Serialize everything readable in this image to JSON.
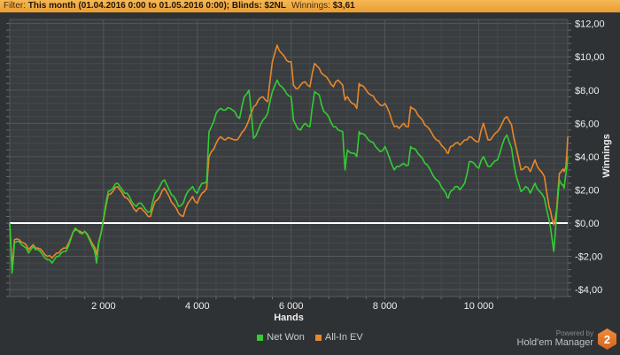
{
  "header": {
    "filter_label": "Filter:",
    "filter_value": "This month (01.04.2016 0:00 to 01.05.2016 0:00); Blinds: $2NL",
    "winnings_label": "Winnings:",
    "winnings_value": "$3,61"
  },
  "chart_data": {
    "type": "line",
    "xlabel": "Hands",
    "ylabel": "Winnings",
    "xlim": [
      0,
      11900
    ],
    "ylim": [
      -4.4,
      12.2
    ],
    "grid": {
      "minor_x_step": 400,
      "minor_y_step": 0.4,
      "major_x_step": 2000,
      "major_y_step": 2,
      "zero_line": 0
    },
    "x_ticks": [
      2000,
      4000,
      6000,
      8000,
      10000
    ],
    "x_tick_labels": [
      "2 000",
      "4 000",
      "6 000",
      "8 000",
      "10 000"
    ],
    "y_ticks": [
      12,
      10,
      8,
      6,
      4,
      2,
      0,
      -2,
      -4
    ],
    "y_tick_labels": [
      "$12,00",
      "$10,00",
      "$8,00",
      "$6,00",
      "$4,00",
      "$2,00",
      "$0,00",
      "-$2,00",
      "-$4,00"
    ],
    "x": [
      0,
      50,
      100,
      200,
      300,
      400,
      500,
      600,
      700,
      800,
      900,
      1000,
      1100,
      1200,
      1300,
      1400,
      1500,
      1600,
      1700,
      1800,
      1850,
      1900,
      2000,
      2100,
      2200,
      2300,
      2400,
      2500,
      2600,
      2700,
      2800,
      2900,
      3000,
      3100,
      3200,
      3300,
      3400,
      3500,
      3600,
      3700,
      3800,
      3900,
      4000,
      4100,
      4200,
      4250,
      4300,
      4400,
      4500,
      4600,
      4700,
      4800,
      4900,
      5000,
      5100,
      5150,
      5200,
      5300,
      5400,
      5500,
      5600,
      5700,
      5800,
      5900,
      6000,
      6050,
      6100,
      6200,
      6300,
      6400,
      6500,
      6600,
      6700,
      6800,
      6900,
      7000,
      7100,
      7150,
      7200,
      7300,
      7400,
      7450,
      7500,
      7600,
      7700,
      7800,
      7900,
      8000,
      8100,
      8200,
      8300,
      8400,
      8500,
      8550,
      8600,
      8700,
      8800,
      8900,
      9000,
      9100,
      9200,
      9300,
      9350,
      9400,
      9500,
      9600,
      9700,
      9800,
      9900,
      10000,
      10100,
      10200,
      10300,
      10400,
      10500,
      10600,
      10700,
      10800,
      10900,
      11000,
      11100,
      11200,
      11300,
      11400,
      11500,
      11560,
      11600,
      11660,
      11720,
      11780,
      11820,
      11860,
      11900
    ],
    "series": [
      {
        "name": "Net Won",
        "color": "#33cc33",
        "values": [
          0,
          -3,
          -1.2,
          -1.1,
          -1.4,
          -1.8,
          -1.4,
          -1.6,
          -1.9,
          -2.2,
          -2.4,
          -2,
          -1.8,
          -1.7,
          -1,
          -0.3,
          -0.6,
          -0.5,
          -1,
          -1.6,
          -2.4,
          -1.2,
          0.3,
          1.9,
          2.1,
          2.4,
          2,
          1.8,
          1.3,
          1,
          1.2,
          0.8,
          0.7,
          1.8,
          2.2,
          2.6,
          2,
          1.6,
          1,
          1.2,
          1.9,
          2.2,
          1.8,
          2.4,
          2.5,
          5.5,
          5.8,
          6.6,
          6.9,
          6.8,
          6.9,
          6.7,
          6.3,
          7.6,
          8,
          6.6,
          5.1,
          5.6,
          6.2,
          6.6,
          7.9,
          8.6,
          8.2,
          7.8,
          7.6,
          6.2,
          5.9,
          5.6,
          6,
          5.8,
          7.9,
          7.7,
          6.7,
          6.4,
          5.8,
          5.6,
          5.5,
          3.2,
          4.4,
          4.2,
          4,
          5.5,
          5.4,
          5.2,
          4.9,
          4.6,
          4.3,
          4.6,
          3.9,
          3.2,
          3.4,
          3.6,
          3.5,
          4.6,
          4.5,
          4.2,
          3.9,
          3.5,
          3,
          2.6,
          2.2,
          1.8,
          1.5,
          1.9,
          2.2,
          2,
          2.4,
          3.7,
          3.6,
          3.3,
          4,
          3.4,
          3.6,
          3.8,
          4.7,
          5.3,
          4.5,
          2.8,
          1.9,
          2.2,
          1.8,
          2.4,
          1.9,
          1.5,
          0.2,
          -0.9,
          -1.7,
          0.5,
          2.6,
          2.3,
          2.1,
          3,
          4
        ]
      },
      {
        "name": "All-In EV",
        "color": "#e8872b",
        "values": [
          0,
          -2.6,
          -1,
          -1,
          -1.2,
          -1.6,
          -1.3,
          -1.5,
          -1.7,
          -2,
          -2.1,
          -1.8,
          -1.6,
          -1.5,
          -0.9,
          -0.4,
          -0.5,
          -0.5,
          -0.9,
          -1.4,
          -1.9,
          -1.1,
          0.2,
          1.7,
          1.9,
          2.2,
          1.8,
          1.5,
          1.1,
          0.7,
          0.9,
          0.6,
          0.4,
          1.3,
          1.6,
          2.1,
          1.6,
          1.1,
          0.6,
          0.4,
          1.2,
          1.6,
          1.2,
          1.8,
          2.1,
          4,
          4.3,
          4.8,
          5.2,
          5,
          5.1,
          5,
          5.2,
          5.6,
          6.2,
          6.6,
          7,
          7.4,
          7.6,
          7.3,
          9.7,
          10.7,
          10.2,
          9.8,
          9.7,
          8.3,
          8.1,
          8.3,
          8.5,
          8.2,
          9.6,
          9.3,
          8.9,
          8.6,
          8.2,
          8.6,
          8.3,
          7.4,
          7.6,
          7.2,
          6.9,
          8.4,
          8.3,
          8,
          7.7,
          7.4,
          7.1,
          7.2,
          6.6,
          5.8,
          5.7,
          6,
          5.8,
          7,
          6.9,
          6.5,
          6.2,
          5.8,
          5.4,
          5,
          4.7,
          4.4,
          4.2,
          4.6,
          4.8,
          4.7,
          5,
          5.2,
          5,
          4.9,
          6,
          5,
          5.2,
          5.5,
          6,
          6.4,
          5.9,
          4.5,
          3.2,
          3.4,
          3.1,
          3.8,
          3.2,
          2.8,
          1,
          0.3,
          -0.1,
          0.8,
          3,
          3.2,
          3.1,
          3.4,
          5.2
        ]
      }
    ],
    "legend_position": "bottom-center"
  },
  "legend": {
    "items": [
      {
        "label": "Net Won",
        "color": "#33cc33"
      },
      {
        "label": "All-In EV",
        "color": "#e8872b"
      }
    ]
  },
  "footer": {
    "powered_by": "Powered by",
    "brand": "Hold'em Manager",
    "badge": "2"
  },
  "colors": {
    "header_bg": "#eda43c",
    "page_bg": "#2f3234",
    "plot_bg": "#3a3d40",
    "grid_minor": "#45484b",
    "grid_major": "#54575a",
    "tick": "#6b6e71",
    "zero_line": "#ffffff",
    "axis_text": "#eceeef",
    "net_won": "#33cc33",
    "all_in_ev": "#e8872b",
    "badge": "#e2752b"
  }
}
